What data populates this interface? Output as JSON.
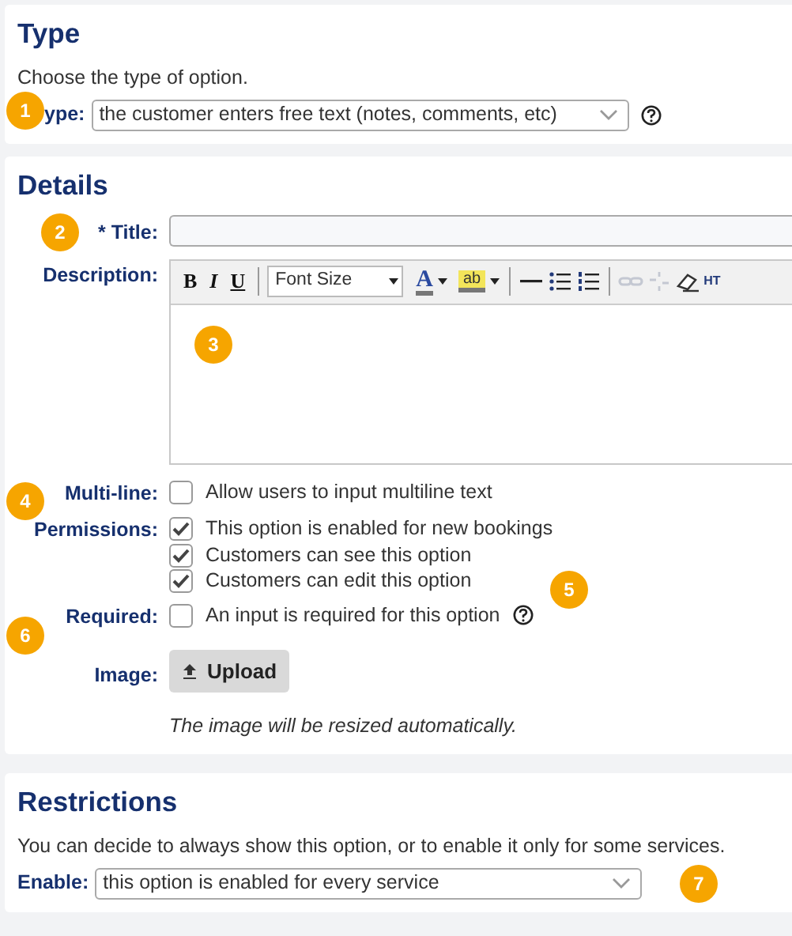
{
  "type_section": {
    "heading": "Type",
    "intro": "Choose the type of option.",
    "label": "ype:",
    "value": "the customer enters free text (notes, comments, etc)",
    "callout": "1"
  },
  "details": {
    "heading": "Details",
    "title": {
      "label": "* Title:",
      "callout": "2"
    },
    "description": {
      "label": "Description:",
      "callout": "3",
      "toolbar": {
        "bold": "B",
        "italic": "I",
        "underline": "U",
        "font_size": "Font Size",
        "font_color": "A",
        "highlight": "ab",
        "html": "HT"
      }
    },
    "multiline": {
      "label": "Multi-line:",
      "callout": "4",
      "options": [
        {
          "text": "Allow users to input multiline text",
          "checked": false
        }
      ]
    },
    "permissions": {
      "label": "Permissions:",
      "callout": "5",
      "options": [
        {
          "text": "This option is enabled for new bookings",
          "checked": true
        },
        {
          "text": "Customers can see this option",
          "checked": true
        },
        {
          "text": "Customers can edit this option",
          "checked": true
        }
      ]
    },
    "required": {
      "label": "Required:",
      "callout": "6",
      "options": [
        {
          "text": "An input is required for this option",
          "checked": false
        }
      ]
    },
    "image": {
      "label": "Image:",
      "button": "Upload",
      "note": "The image will be resized automatically."
    }
  },
  "restrictions": {
    "heading": "Restrictions",
    "intro": "You can decide to always show this option, or to enable it only for some services.",
    "label": "Enable:",
    "value": "this option is enabled for every service",
    "callout": "7"
  }
}
